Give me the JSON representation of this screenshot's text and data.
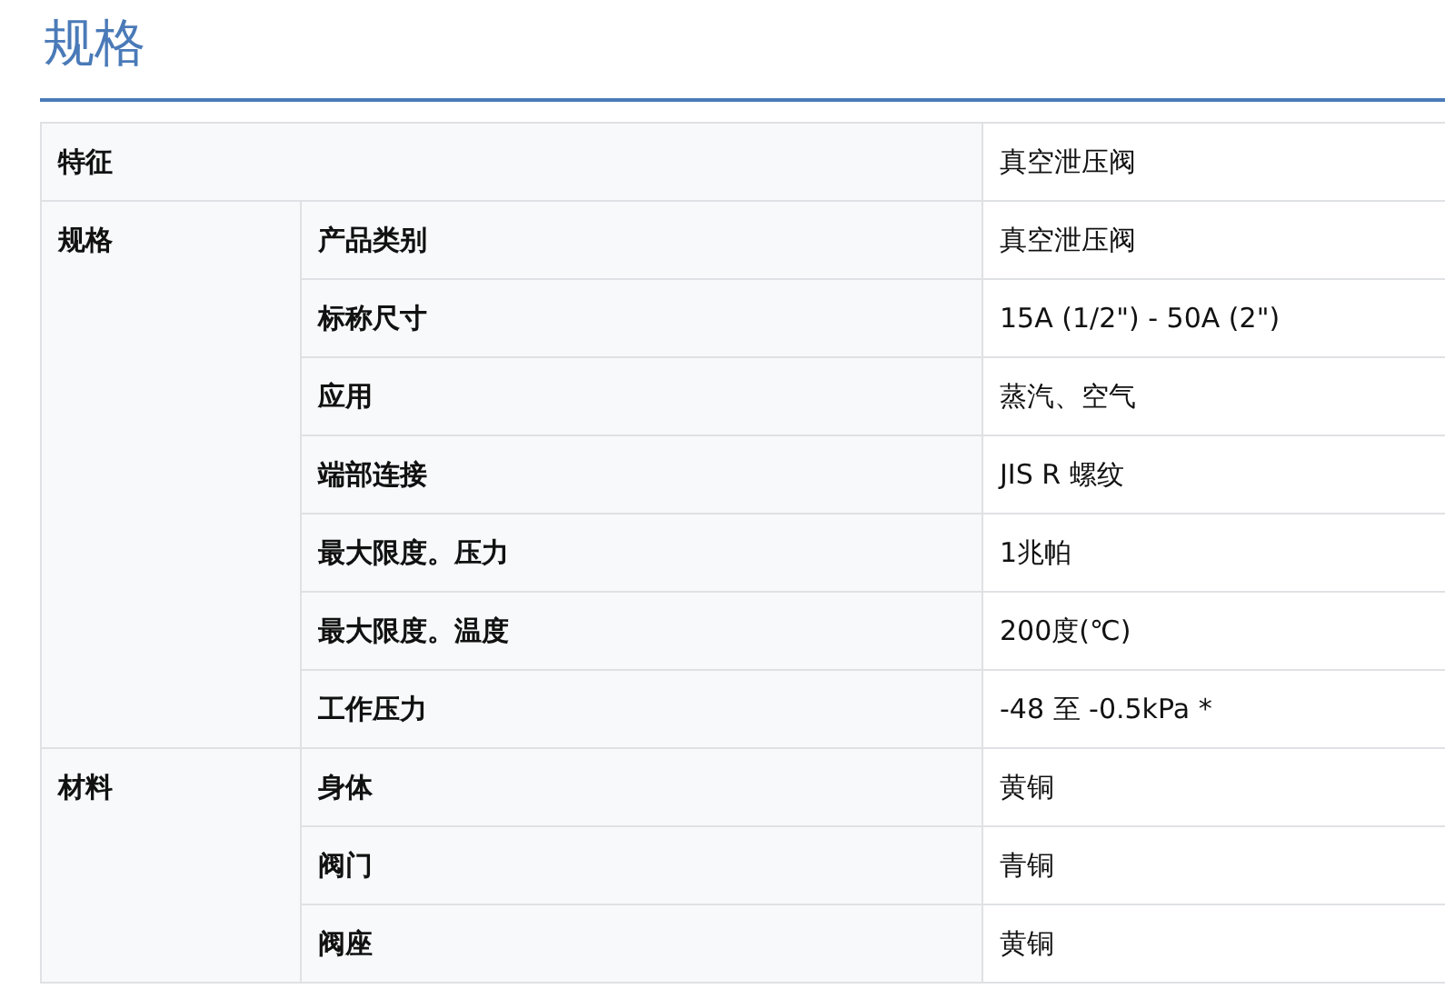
{
  "title": "规格",
  "feature": {
    "label": "特征",
    "value": "真空泄压阀"
  },
  "groups": [
    {
      "label": "规格",
      "rows": [
        {
          "name": "产品类别",
          "value": "真空泄压阀"
        },
        {
          "name": "标称尺寸",
          "value": "15A (1/2\") - 50A (2\")"
        },
        {
          "name": "应用",
          "value": "蒸汽、空气"
        },
        {
          "name": "端部连接",
          "value": "JIS R 螺纹"
        },
        {
          "name": "最大限度。压力",
          "value": "1兆帕"
        },
        {
          "name": "最大限度。温度",
          "value": "200度(℃)"
        },
        {
          "name": "工作压力",
          "value": "-48 至 -0.5kPa *"
        }
      ]
    },
    {
      "label": "材料",
      "rows": [
        {
          "name": "身体",
          "value": "黄铜"
        },
        {
          "name": "阀门",
          "value": "青铜"
        },
        {
          "name": "阀座",
          "value": "黄铜"
        }
      ]
    }
  ]
}
